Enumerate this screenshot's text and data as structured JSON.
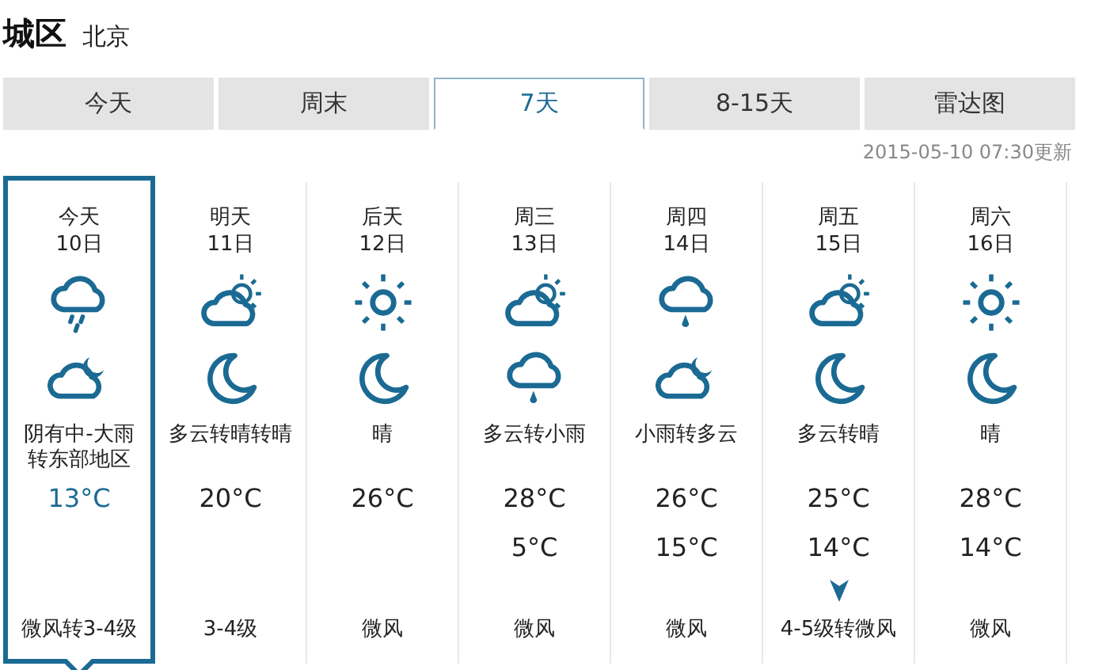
{
  "header": {
    "district": "城区",
    "city": "北京"
  },
  "tabs": [
    {
      "label": "今天",
      "selected": false
    },
    {
      "label": "周末",
      "selected": false
    },
    {
      "label": "7天",
      "selected": true
    },
    {
      "label": "8-15天",
      "selected": false
    },
    {
      "label": "雷达图",
      "selected": false
    }
  ],
  "updated": "2015-05-10 07:30更新",
  "days": [
    {
      "name": "今天",
      "date": "10日",
      "day_weather": {
        "kind": "heavy-rain"
      },
      "night_weather": {
        "kind": "cloud-moon"
      },
      "description": "阴有中-大雨转东部地区",
      "high": "13°C",
      "wind": "微风转3-4级",
      "wind_mark": false,
      "selected": true
    },
    {
      "name": "明天",
      "date": "11日",
      "day_weather": {
        "kind": "sun-cloud"
      },
      "night_weather": {
        "kind": "moon"
      },
      "description": "多云转晴转晴",
      "high": "20°C",
      "wind": "3-4级",
      "wind_mark": false,
      "selected": false
    },
    {
      "name": "后天",
      "date": "12日",
      "day_weather": {
        "kind": "sun"
      },
      "night_weather": {
        "kind": "moon"
      },
      "description": "晴",
      "high": "26°C",
      "wind": "微风",
      "wind_mark": false,
      "selected": false
    },
    {
      "name": "周三",
      "date": "13日",
      "day_weather": {
        "kind": "sun-cloud"
      },
      "night_weather": {
        "kind": "light-rain"
      },
      "description": "多云转小雨",
      "high": "28°C",
      "low": "5°C",
      "wind": "微风",
      "wind_mark": false,
      "selected": false
    },
    {
      "name": "周四",
      "date": "14日",
      "day_weather": {
        "kind": "light-rain"
      },
      "night_weather": {
        "kind": "cloud-moon"
      },
      "description": "小雨转多云",
      "high": "26°C",
      "low": "15°C",
      "wind": "微风",
      "wind_mark": false,
      "selected": false
    },
    {
      "name": "周五",
      "date": "15日",
      "day_weather": {
        "kind": "sun-cloud"
      },
      "night_weather": {
        "kind": "moon"
      },
      "description": "多云转晴",
      "high": "25°C",
      "low": "14°C",
      "wind": "4-5级转微风",
      "wind_mark": true,
      "selected": false
    },
    {
      "name": "周六",
      "date": "16日",
      "day_weather": {
        "kind": "sun"
      },
      "night_weather": {
        "kind": "moon"
      },
      "description": "晴",
      "high": "28°C",
      "low": "14°C",
      "wind": "微风",
      "wind_mark": false,
      "selected": false
    }
  ]
}
